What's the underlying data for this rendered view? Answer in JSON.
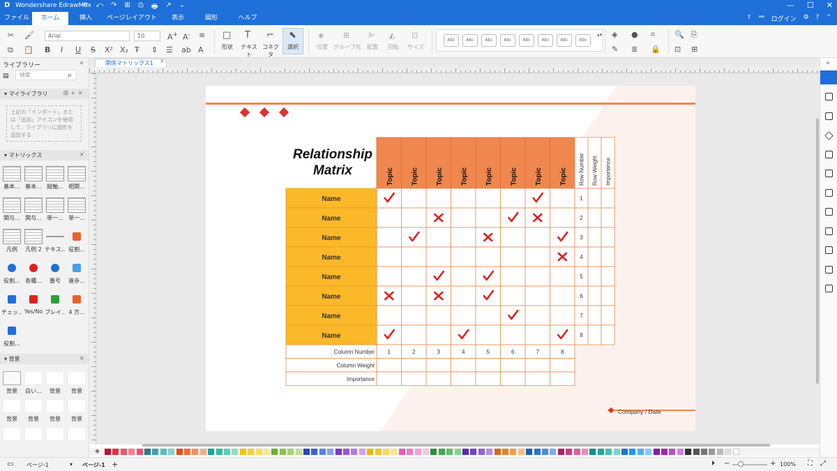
{
  "titlebar": {
    "logo": "D",
    "title": "Wondershare EdrawMax",
    "quick": [
      "↶",
      "⤺",
      "↷",
      "⊞",
      "⎙",
      "🖶",
      "↗",
      "⌄"
    ],
    "win": [
      "—",
      "☐",
      "✕"
    ]
  },
  "menu": {
    "tabs": [
      "ファイル",
      "ホーム",
      "挿入",
      "ページレイアウト",
      "表示",
      "図形",
      "ヘルプ"
    ],
    "active": 1,
    "right": [
      "⇧",
      "⚯",
      "ログイン",
      "⚙",
      "?",
      "⌃"
    ]
  },
  "ribbon": {
    "font_name": "Arial",
    "font_size": "10",
    "tools": [
      "形状",
      "テキスト",
      "コネクタ",
      "選択"
    ],
    "arrange": [
      "位置",
      "グループ化",
      "配置",
      "回転",
      "サイズ"
    ],
    "styles": [
      "Abc",
      "Abc",
      "Abc",
      "Abc",
      "Abc",
      "Abc",
      "Abc",
      "Abc"
    ]
  },
  "sidebar": {
    "library_label": "ライブラリー",
    "search_placeholder": "検索",
    "mylib_title": "マイライブラリ",
    "mylib_hint": "上記の「インポート」または「追加」アイコンを使用して、ライブラリに図形を追加する",
    "matrix_title": "マトリックス",
    "shapes": [
      "基本...",
      "基本...",
      "縦軸...",
      "相関...",
      "関与...",
      "関与...",
      "単一...",
      "単一...",
      "凡例",
      "凡例 2",
      "テキス...",
      "役割...",
      "役割...",
      "各種...",
      "番号",
      "進歩...",
      "チェッ...",
      "Yes/No",
      "プレイ...",
      "4 方...",
      "役割..."
    ],
    "bg_title": "背景",
    "bg_labels": [
      "背景",
      "白い...",
      "背景",
      "背景",
      "背景",
      "背景",
      "背景",
      "背景",
      "背景",
      "背景",
      "背景",
      "背景"
    ]
  },
  "doc": {
    "tab": "関係マトリックス1"
  },
  "diagram": {
    "title": "Relationship Matrix",
    "col_headers": [
      "Topic",
      "Topic",
      "Topic",
      "Topic",
      "Topic",
      "Topic",
      "Topic",
      "Topic"
    ],
    "extra_headers": [
      "Row Number",
      "Row Weight",
      "Importance"
    ],
    "row_labels": [
      "Name",
      "Name",
      "Name",
      "Name",
      "Name",
      "Name",
      "Name",
      "Name"
    ],
    "row_numbers": [
      "1",
      "2",
      "3",
      "4",
      "5",
      "6",
      "7",
      "8"
    ],
    "column_numbers": [
      "1",
      "2",
      "3",
      "4",
      "5",
      "6",
      "7",
      "8"
    ],
    "bottom_labels": [
      "Column Number",
      "Column Weight",
      "Importance"
    ],
    "marks": [
      [
        "check",
        "",
        "",
        "",
        "",
        "",
        "check",
        ""
      ],
      [
        "",
        "",
        "cross",
        "",
        "",
        "check",
        "cross",
        ""
      ],
      [
        "",
        "check",
        "",
        "",
        "cross",
        "",
        "",
        "check"
      ],
      [
        "",
        "",
        "",
        "",
        "",
        "",
        "",
        "cross"
      ],
      [
        "",
        "",
        "check",
        "",
        "check",
        "",
        "",
        ""
      ],
      [
        "cross",
        "",
        "cross",
        "",
        "check",
        "",
        "",
        ""
      ],
      [
        "",
        "",
        "",
        "",
        "",
        "check",
        "",
        ""
      ],
      [
        "check",
        "",
        "",
        "check",
        "",
        "",
        "",
        "check"
      ]
    ],
    "footer": "Company / Date",
    "colors": {
      "accent": "#f0874f",
      "row_label": "#fbb829",
      "mark": "#e02020",
      "line": "#f08a4b"
    }
  },
  "palette": [
    "#c8102e",
    "#e0313f",
    "#e8586a",
    "#f07f8f",
    "#ef4f6f",
    "#2b7a8a",
    "#3ca2b0",
    "#56c0c6",
    "#7fd3d3",
    "#e84c1e",
    "#f26d3d",
    "#f78e60",
    "#f9ac85",
    "#1ba39c",
    "#35bba5",
    "#5bcfb5",
    "#8fe0c8",
    "#f5c400",
    "#f7d230",
    "#f9de60",
    "#fbe890",
    "#6fae3a",
    "#8cc152",
    "#a8d270",
    "#c4e190",
    "#2545b8",
    "#3b62d3",
    "#5a80e0",
    "#85a2ea",
    "#7a36c8",
    "#9656d8",
    "#b07ae2",
    "#cba2ec",
    "#e8b800",
    "#f0c830",
    "#f5d860",
    "#fae690",
    "#e25fb0",
    "#ea80c2",
    "#f1a2d4",
    "#f7c4e4",
    "#2f8f3a",
    "#43a84d",
    "#5fbf68",
    "#85d38b",
    "#5a2bb0",
    "#7440c8",
    "#9062d8",
    "#b090e4",
    "#d66a1c",
    "#e0852c",
    "#ea9f50",
    "#f3bf80",
    "#1a5fb4",
    "#2a76d2",
    "#4a90e0",
    "#78b0ea",
    "#b2206c",
    "#ca3c86",
    "#dc60a0",
    "#e88cbc",
    "#0f8f86",
    "#26a89d",
    "#46c0b4",
    "#7ad4c9",
    "#1976d2",
    "#2196f3",
    "#4fb0f6",
    "#85c8f9",
    "#7b1fa2",
    "#9c27b0",
    "#b452c4",
    "#cc82d8",
    "#333333",
    "#555555",
    "#777777",
    "#999999",
    "#bbbbbb",
    "#dddddd",
    "#ffffff"
  ],
  "status": {
    "page_sel": "ページ-1",
    "page_tab": "ページ-1",
    "add": "+",
    "zoom": "100%"
  }
}
